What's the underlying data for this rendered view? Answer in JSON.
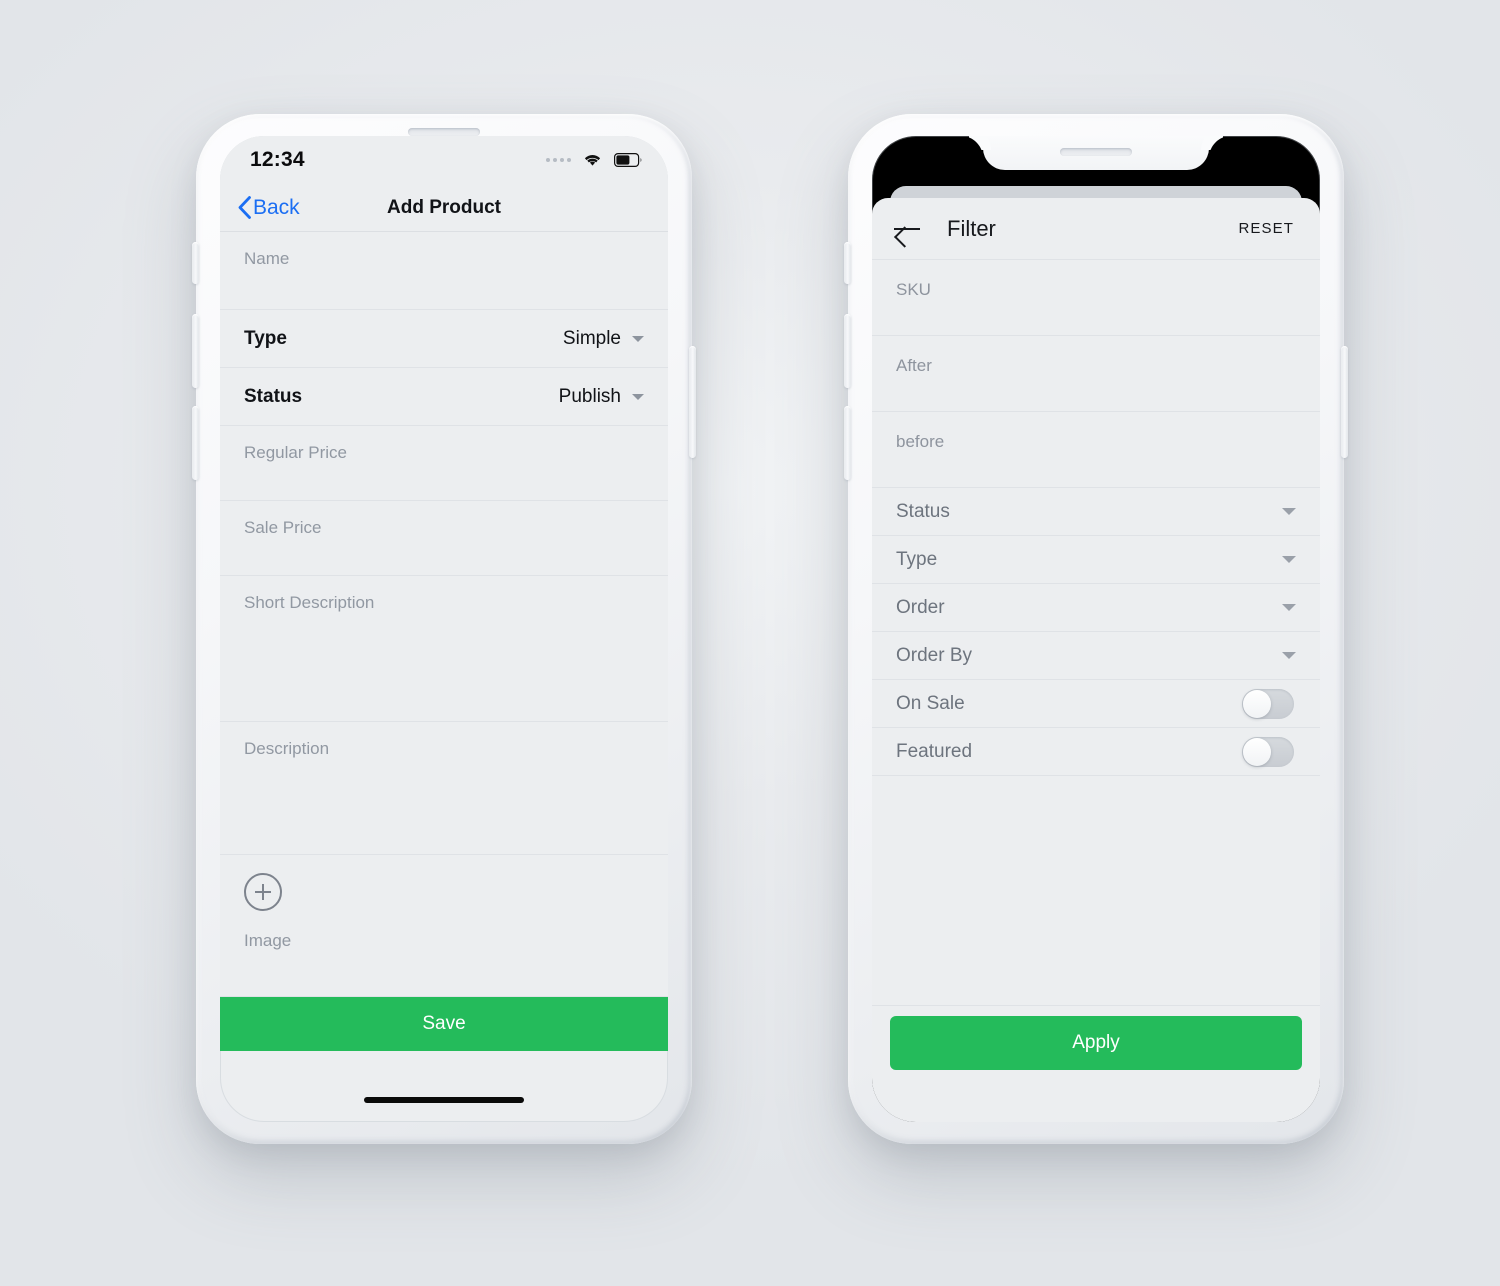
{
  "background": {
    "color": "#e9ebee"
  },
  "accent": {
    "green": "#24bb5b",
    "ios_blue": "#1b6ef3"
  },
  "left_phone": {
    "status_bar": {
      "time": "12:34",
      "signal_icon": "signal-dots-icon",
      "wifi_icon": "wifi-icon",
      "battery_icon": "battery-icon"
    },
    "nav": {
      "back_label": "Back",
      "back_icon": "chevron-left-icon",
      "title": "Add Product"
    },
    "fields": {
      "name_placeholder": "Name",
      "regular_price_placeholder": "Regular Price",
      "sale_price_placeholder": "Sale Price",
      "short_description_placeholder": "Short Description",
      "description_placeholder": "Description",
      "image_label": "Image",
      "add_image_icon": "plus-circle-icon"
    },
    "selects": [
      {
        "label": "Type",
        "value": "Simple",
        "icon": "caret-down-icon"
      },
      {
        "label": "Status",
        "value": "Publish",
        "icon": "caret-down-icon"
      }
    ],
    "save_button": "Save"
  },
  "right_phone": {
    "app_bar": {
      "back_icon": "arrow-left-icon",
      "title": "Filter",
      "reset_label": "RESET"
    },
    "fields": {
      "sku_placeholder": "SKU",
      "after_placeholder": "After",
      "before_placeholder": "before"
    },
    "selects": [
      {
        "label": "Status",
        "icon": "caret-down-icon"
      },
      {
        "label": "Type",
        "icon": "caret-down-icon"
      },
      {
        "label": "Order",
        "icon": "caret-down-icon"
      },
      {
        "label": "Order By",
        "icon": "caret-down-icon"
      }
    ],
    "toggles": [
      {
        "label": "On Sale",
        "state": "off"
      },
      {
        "label": "Featured",
        "state": "off"
      }
    ],
    "apply_button": "Apply"
  }
}
